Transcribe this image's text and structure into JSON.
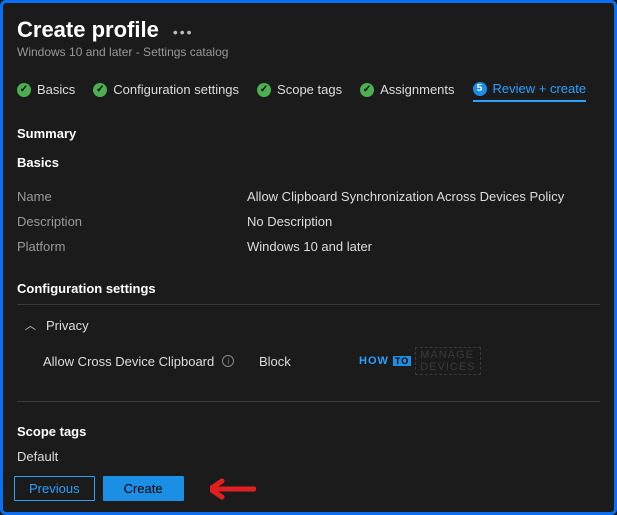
{
  "header": {
    "title": "Create profile",
    "subtitle": "Windows 10 and later - Settings catalog"
  },
  "tabs": {
    "t1": "Basics",
    "t2": "Configuration settings",
    "t3": "Scope tags",
    "t4": "Assignments",
    "t5_num": "5",
    "t5": "Review + create"
  },
  "summary": {
    "heading": "Summary",
    "basics_heading": "Basics",
    "name_k": "Name",
    "name_v": "Allow Clipboard Synchronization Across Devices Policy",
    "desc_k": "Description",
    "desc_v": "No Description",
    "plat_k": "Platform",
    "plat_v": "Windows 10 and later"
  },
  "config": {
    "heading": "Configuration settings",
    "privacy": "Privacy",
    "setting_k": "Allow Cross Device Clipboard",
    "setting_v": "Block"
  },
  "watermark": {
    "how": "HOW",
    "to": "TO",
    "m": "MANAGE",
    "d": "DEVICES"
  },
  "scope": {
    "heading": "Scope tags",
    "value": "Default"
  },
  "footer": {
    "prev": "Previous",
    "create": "Create"
  }
}
